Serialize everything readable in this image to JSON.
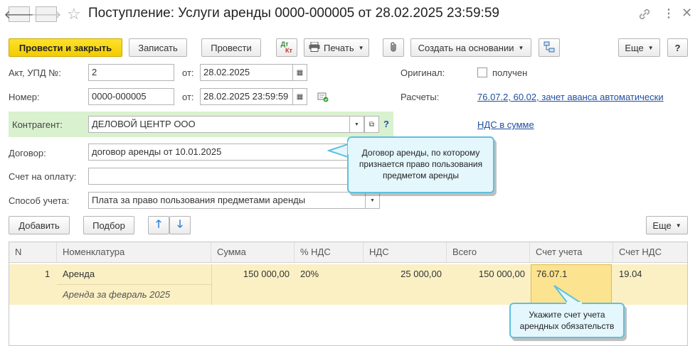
{
  "header": {
    "title": "Поступление: Услуги аренды 0000-000005 от 28.02.2025 23:59:59"
  },
  "toolbar": {
    "post_close": "Провести и закрыть",
    "save": "Записать",
    "post": "Провести",
    "dtkt_top": "Дт",
    "dtkt_bottom": "Кт",
    "print": "Печать",
    "create_based": "Создать на основании",
    "more": "Еще",
    "help": "?"
  },
  "form": {
    "act_label": "Акт, УПД №:",
    "act_value": "2",
    "from_label": "от:",
    "act_date": "28.02.2025",
    "number_label": "Номер:",
    "number_value": "0000-000005",
    "number_date": "28.02.2025 23:59:59",
    "original_label": "Оригинал:",
    "original_checkbox_label": "получен",
    "payments_label": "Расчеты:",
    "payments_link": "76.07.2, 60.02, зачет аванса автоматически",
    "counterparty_label": "Контрагент:",
    "counterparty_value": "ДЕЛОВОЙ ЦЕНТР ООО",
    "help_mark": "?",
    "vat_link": "НДС в сумме",
    "contract_label": "Договор:",
    "contract_value": "договор аренды от 10.01.2025",
    "invoice_label": "Счет на оплату:",
    "invoice_value": "",
    "accounting_label": "Способ учета:",
    "accounting_value": "Плата за право пользования предметами аренды"
  },
  "table_toolbar": {
    "add": "Добавить",
    "pick": "Подбор",
    "more": "Еще"
  },
  "table": {
    "columns": [
      "N",
      "Номенклатура",
      "Сумма",
      "% НДС",
      "НДС",
      "Всего",
      "Счет учета",
      "Счет НДС"
    ],
    "rows": [
      {
        "n": "1",
        "item": "Аренда",
        "item_desc": "Аренда за февраль 2025",
        "sum": "150 000,00",
        "vat_rate": "20%",
        "vat": "25 000,00",
        "total": "150 000,00",
        "account": "76.07.1",
        "vat_account": "19.04"
      }
    ]
  },
  "callouts": {
    "contract": "Договор аренды, по которому признается право пользования предметом аренды",
    "account": "Укажите счет учета арендных обязательств"
  },
  "colors": {
    "primary_button": "#f5d10c",
    "counterparty_row": "#d9f1cf",
    "selected_row": "#fbf0c4",
    "selected_cell": "#fbe390",
    "link": "#1f4fa0",
    "callout_border": "#5fc1dd",
    "callout_bg": "#e4f7fd"
  }
}
